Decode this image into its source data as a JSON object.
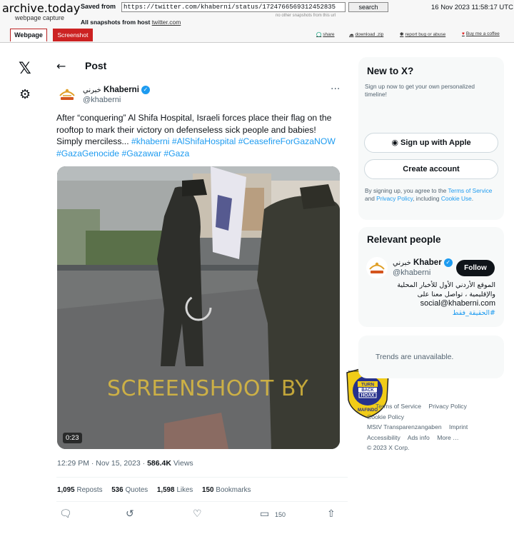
{
  "archive": {
    "logo": "archive.today",
    "subtitle": "webpage capture",
    "saved_from_label": "Saved from",
    "url": "https://twitter.com/khaberni/status/1724766569312452835",
    "search_label": "search",
    "date": "16 Nov 2023 11:58:17 UTC",
    "no_other": "no other snapshots from this url",
    "all_snapshots_label": "All snapshots",
    "from_host_label": "from host",
    "host": "twitter.com",
    "tab_webpage": "Webpage",
    "tab_screenshot": "Screenshot",
    "links": [
      "share",
      "download .zip",
      "report bug or abuse",
      "Buy me a coffee"
    ]
  },
  "nav": {
    "logo_icon": "x-logo-icon",
    "settings_icon": "gear-icon"
  },
  "post": {
    "heading": "Post",
    "author_arabic": "خبرني",
    "author_name": "Khaberni",
    "handle": "@khaberni",
    "text": "After “conquering” Al Shifa Hospital, Israeli forces place their flag on the rooftop to mark their victory on defenseless sick people and babies! Simply merciless...",
    "hashtags": "#khaberni #AlShifaHospital #CeasefireForGazaNOW #GazaGenocide #Gazawar #Gaza",
    "video_duration": "0:23",
    "watermark": "SCREENSHOOT BY",
    "badge": {
      "top": "MASYARAKAT ANTI FITNAH INDONESIA",
      "line1": "TURN",
      "line2": "BACK",
      "line3": "HOAX",
      "bottom": "MAFINDO"
    },
    "time": "12:29 PM · Nov 15, 2023 ·",
    "views_count": "586.4K",
    "views_label": "Views",
    "reposts_count": "1,095",
    "reposts_label": "Reposts",
    "quotes_count": "536",
    "quotes_label": "Quotes",
    "likes_count": "1,598",
    "likes_label": "Likes",
    "bookmarks_count": "150",
    "bookmarks_label": "Bookmarks",
    "bookmark_action_count": "150"
  },
  "sidebar": {
    "new_to_x": "New to X?",
    "signup_text": "Sign up now to get your own personalized timeline!",
    "apple_button": "Sign up with Apple",
    "create_account": "Create account",
    "terms_prefix": "By signing up, you agree to the",
    "terms_link": "Terms of Service",
    "and": "and",
    "privacy_link": "Privacy Policy",
    "including": ", including",
    "cookie_link": "Cookie Use",
    "period": ".",
    "relevant_title": "Relevant people",
    "person_arabic": "خبرني",
    "person_name": "Khaber",
    "person_handle": "@khaberni",
    "follow_label": "Follow",
    "bio_line1": "الموقع الأردني الأول للأخبار المحلية",
    "bio_line2": "والإقليمية ، تواصل معنا على",
    "bio_line3": "social@khaberni.com",
    "bio_line4": "#الحقيقة_فقط",
    "trends": "Trends are unavailable.",
    "footer_links": [
      "Terms of Service",
      "Privacy Policy",
      "Cookie Policy",
      "MStV Transparenzangaben",
      "Imprint",
      "Accessibility",
      "Ads info",
      "More …",
      "© 2023 X Corp."
    ]
  }
}
